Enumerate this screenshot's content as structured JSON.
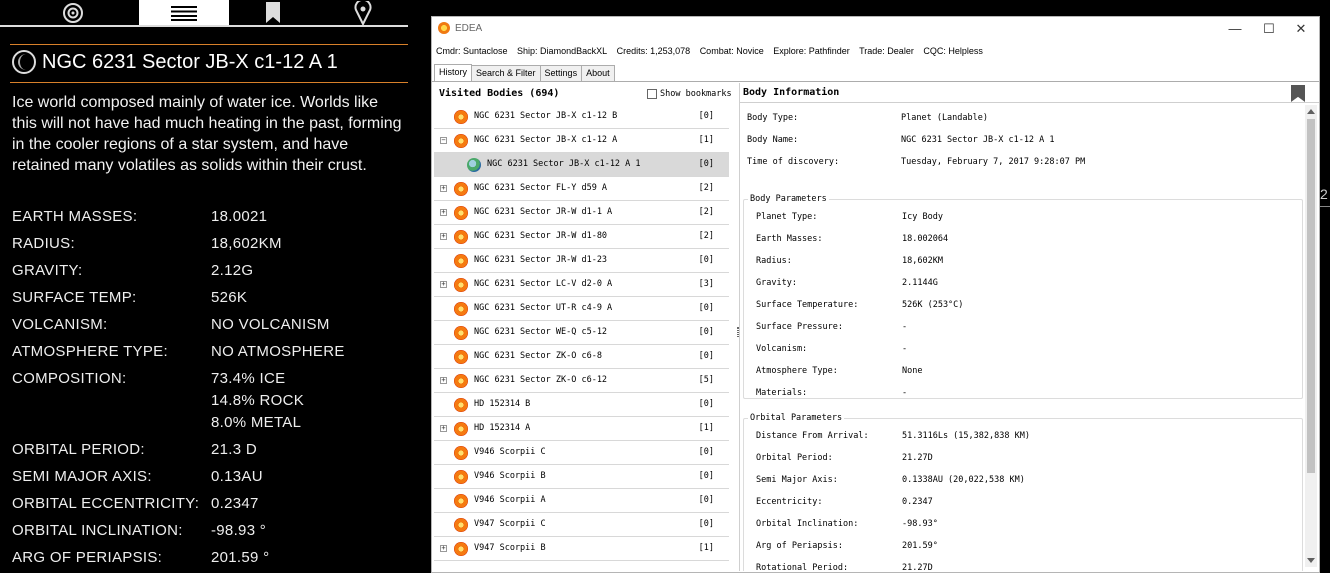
{
  "game": {
    "tabs": [
      {
        "icon": "target-icon"
      },
      {
        "icon": "list-icon",
        "active": true
      },
      {
        "icon": "bookmark-icon"
      },
      {
        "icon": "map-pin-icon"
      }
    ],
    "body_name": "NGC 6231 Sector JB-X c1-12 A 1",
    "description": "Ice world composed mainly of water ice. Worlds like this will not have had much heating in the past, forming in the cooler regions of a star system, and have retained many volatiles as solids within their crust.",
    "stats": [
      {
        "label": "EARTH MASSES:",
        "value": "18.0021"
      },
      {
        "label": "RADIUS:",
        "value": "18,602KM"
      },
      {
        "label": "GRAVITY:",
        "value": "2.12G"
      },
      {
        "label": "SURFACE TEMP:",
        "value": "526K"
      },
      {
        "label": "VOLCANISM:",
        "value": "NO VOLCANISM"
      },
      {
        "label": "ATMOSPHERE TYPE:",
        "value": "NO ATMOSPHERE"
      },
      {
        "label": "COMPOSITION:",
        "value": "73.4% ICE"
      },
      {
        "label": "",
        "value": "14.8% ROCK"
      },
      {
        "label": "",
        "value": "8.0% METAL"
      },
      {
        "label": "ORBITAL PERIOD:",
        "value": "21.3 D"
      },
      {
        "label": "SEMI MAJOR AXIS:",
        "value": "0.13AU"
      },
      {
        "label": "ORBITAL ECCENTRICITY:",
        "value": "0.2347"
      },
      {
        "label": "ORBITAL INCLINATION:",
        "value": "-98.93 °"
      },
      {
        "label": "ARG OF PERIAPSIS:",
        "value": "201.59 °"
      }
    ],
    "edge_fragment": "2"
  },
  "window": {
    "title": "EDEA",
    "controls": {
      "minimize": "—",
      "maximize": "☐",
      "close": "✕"
    },
    "info": [
      "Cmdr: Suntaclose",
      "Ship: DiamondBackXL",
      "Credits: 1,253,078",
      "Combat: Novice",
      "Explore: Pathfinder",
      "Trade: Dealer",
      "CQC: Helpless"
    ],
    "tabs": [
      "History",
      "Search & Filter",
      "Settings",
      "About"
    ],
    "list": {
      "title": "Visited Bodies (694)",
      "bookmarks_label": "Show bookmarks",
      "rows": [
        {
          "name": "NGC 6231 Sector JB-X c1-12 B",
          "count": "[0]",
          "expander": "",
          "indent": 0,
          "icon": "star"
        },
        {
          "name": "NGC 6231 Sector JB-X c1-12 A",
          "count": "[1]",
          "expander": "−",
          "indent": 0,
          "icon": "star"
        },
        {
          "name": "NGC 6231 Sector JB-X c1-12 A 1",
          "count": "[0]",
          "expander": "",
          "indent": 1,
          "icon": "planet",
          "selected": true
        },
        {
          "name": "NGC 6231 Sector FL-Y d59 A",
          "count": "[2]",
          "expander": "+",
          "indent": 0,
          "icon": "star"
        },
        {
          "name": "NGC 6231 Sector JR-W d1-1 A",
          "count": "[2]",
          "expander": "+",
          "indent": 0,
          "icon": "star"
        },
        {
          "name": "NGC 6231 Sector JR-W d1-80",
          "count": "[2]",
          "expander": "+",
          "indent": 0,
          "icon": "star"
        },
        {
          "name": "NGC 6231 Sector JR-W d1-23",
          "count": "[0]",
          "expander": "",
          "indent": 0,
          "icon": "star"
        },
        {
          "name": "NGC 6231 Sector LC-V d2-0 A",
          "count": "[3]",
          "expander": "+",
          "indent": 0,
          "icon": "star"
        },
        {
          "name": "NGC 6231 Sector UT-R c4-9 A",
          "count": "[0]",
          "expander": "",
          "indent": 0,
          "icon": "star"
        },
        {
          "name": "NGC 6231 Sector WE-Q c5-12",
          "count": "[0]",
          "expander": "",
          "indent": 0,
          "icon": "star"
        },
        {
          "name": "NGC 6231 Sector ZK-O c6-8",
          "count": "[0]",
          "expander": "",
          "indent": 0,
          "icon": "star"
        },
        {
          "name": "NGC 6231 Sector ZK-O c6-12",
          "count": "[5]",
          "expander": "+",
          "indent": 0,
          "icon": "star"
        },
        {
          "name": "HD 152314 B",
          "count": "[0]",
          "expander": "",
          "indent": 0,
          "icon": "star"
        },
        {
          "name": "HD 152314 A",
          "count": "[1]",
          "expander": "+",
          "indent": 0,
          "icon": "star"
        },
        {
          "name": "V946 Scorpii C",
          "count": "[0]",
          "expander": "",
          "indent": 0,
          "icon": "star"
        },
        {
          "name": "V946 Scorpii B",
          "count": "[0]",
          "expander": "",
          "indent": 0,
          "icon": "star"
        },
        {
          "name": "V946 Scorpii A",
          "count": "[0]",
          "expander": "",
          "indent": 0,
          "icon": "star"
        },
        {
          "name": "V947 Scorpii C",
          "count": "[0]",
          "expander": "",
          "indent": 0,
          "icon": "star"
        },
        {
          "name": "V947 Scorpii B",
          "count": "[1]",
          "expander": "+",
          "indent": 0,
          "icon": "star"
        }
      ]
    },
    "detail": {
      "title": "Body Information",
      "top_fields": [
        {
          "label": "Body Type:",
          "value": "Planet (Landable)"
        },
        {
          "label": "Body Name:",
          "value": "NGC 6231 Sector JB-X c1-12 A 1"
        },
        {
          "label": "Time of discovery:",
          "value": "Tuesday, February 7, 2017 9:28:07 PM"
        }
      ],
      "body_params_title": "Body Parameters",
      "body_params": [
        {
          "label": "Planet Type:",
          "value": "Icy Body"
        },
        {
          "label": "Earth Masses:",
          "value": "18.002064"
        },
        {
          "label": "Radius:",
          "value": "18,602KM"
        },
        {
          "label": "Gravity:",
          "value": "2.1144G"
        },
        {
          "label": "Surface Temperature:",
          "value": "526K (253°C)"
        },
        {
          "label": "Surface Pressure:",
          "value": "-"
        },
        {
          "label": "Volcanism:",
          "value": "-"
        },
        {
          "label": "Atmosphere Type:",
          "value": "None"
        },
        {
          "label": "Materials:",
          "value": "-"
        }
      ],
      "orbital_params_title": "Orbital Parameters",
      "orbital_params": [
        {
          "label": "Distance From Arrival:",
          "value": "51.3116Ls (15,382,838 KM)"
        },
        {
          "label": "Orbital Period:",
          "value": "21.27D"
        },
        {
          "label": "Semi Major Axis:",
          "value": "0.1338AU (20,022,538 KM)"
        },
        {
          "label": "Eccentricity:",
          "value": "0.2347"
        },
        {
          "label": "Orbital Inclination:",
          "value": "-98.93°"
        },
        {
          "label": "Arg of Periapsis:",
          "value": "201.59°"
        },
        {
          "label": "Rotational Period:",
          "value": "21.27D"
        }
      ]
    }
  }
}
